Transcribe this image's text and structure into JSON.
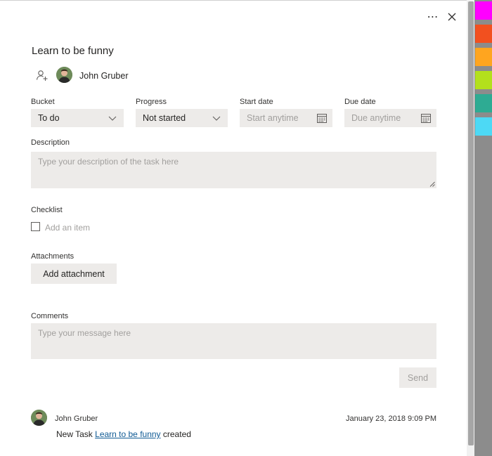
{
  "task": {
    "title": "Learn to be funny",
    "assignee": "John Gruber"
  },
  "fields": {
    "bucket_label": "Bucket",
    "bucket_value": "To do",
    "progress_label": "Progress",
    "progress_value": "Not started",
    "start_label": "Start date",
    "start_placeholder": "Start anytime",
    "due_label": "Due date",
    "due_placeholder": "Due anytime"
  },
  "description": {
    "label": "Description",
    "placeholder": "Type your description of the task here"
  },
  "checklist": {
    "label": "Checklist",
    "placeholder": "Add an item"
  },
  "attachments": {
    "label": "Attachments",
    "button": "Add attachment"
  },
  "comments": {
    "label": "Comments",
    "placeholder": "Type your message here",
    "send_button": "Send",
    "entry": {
      "author": "John Gruber",
      "timestamp": "January 23, 2018 9:09 PM",
      "text_prefix": "New Task",
      "link_text": "Learn to be funny",
      "text_suffix": "created"
    }
  },
  "toolbar": {
    "more_label": "⋯"
  },
  "colors": {
    "swatches": [
      "#ff00ff",
      "#f2501f",
      "#ffa51f",
      "#b3e01c",
      "#2eab93",
      "#4dd9f5"
    ]
  },
  "icons": {
    "more": "more-icon",
    "close": "close-icon",
    "assign": "assign-user-icon",
    "chevron": "chevron-down-icon",
    "calendar": "calendar-icon"
  }
}
